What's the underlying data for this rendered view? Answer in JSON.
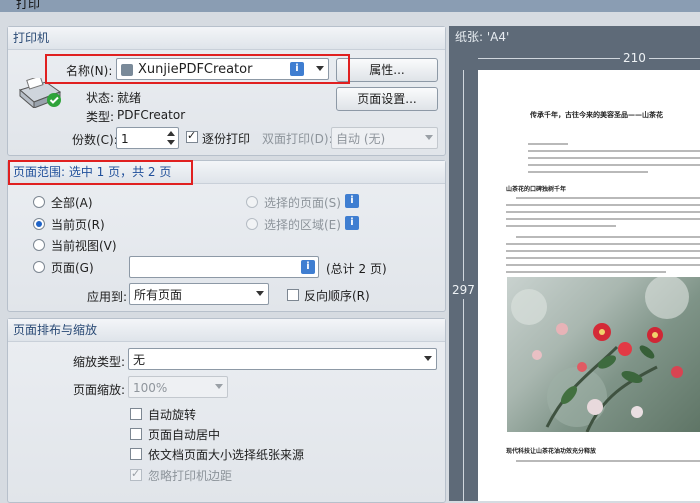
{
  "window": {
    "title": "打印"
  },
  "printer": {
    "group_title": "打印机",
    "name_label": "名称(N):",
    "name_value": "XunjiePDFCreator",
    "properties_button": "属性...",
    "status_label": "状态:",
    "status_value": "就绪",
    "type_label": "类型:",
    "type_value": "PDFCreator",
    "page_setup_button": "页面设置...",
    "copies_label": "份数(C):",
    "copies_value": "1",
    "collate_label": "逐份打印",
    "duplex_label": "双面打印(D):",
    "duplex_value": "自动 (无)"
  },
  "page_range": {
    "title": "页面范围: 选中 1 页，共 2 页",
    "all": "全部(A)",
    "current_page": "当前页(R)",
    "current_view": "当前视图(V)",
    "pages": "页面(G)",
    "selected_pages": "选择的页面(S)",
    "selected_area": "选择的区域(E)",
    "total_pages": "(总计 2 页)",
    "apply_label": "应用到:",
    "apply_value": "所有页面",
    "reverse_order": "反向顺序(R)"
  },
  "layout": {
    "group_title": "页面排布与缩放",
    "scale_type_label": "缩放类型:",
    "scale_type_value": "无",
    "zoom_label": "页面缩放:",
    "zoom_value": "100%",
    "auto_rotate": "自动旋转",
    "auto_center": "页面自动居中",
    "paper_source": "依文档页面大小选择纸张来源",
    "ignore_margins": "忽略打印机边距"
  },
  "preview": {
    "paper_label": "纸张: 'A4'",
    "width_mm": "210",
    "height_mm": "297",
    "doc_title": "传承千年，古往今来的美容圣品——山茶花",
    "section1": "山茶花的口碑独树千年",
    "section2": "现代科技让山茶花油功效充分释放"
  },
  "icons": {
    "info": "i"
  },
  "colors": {
    "accent": "#2a4a75",
    "highlight": "#e02020",
    "link_blue": "#1f63c7"
  }
}
